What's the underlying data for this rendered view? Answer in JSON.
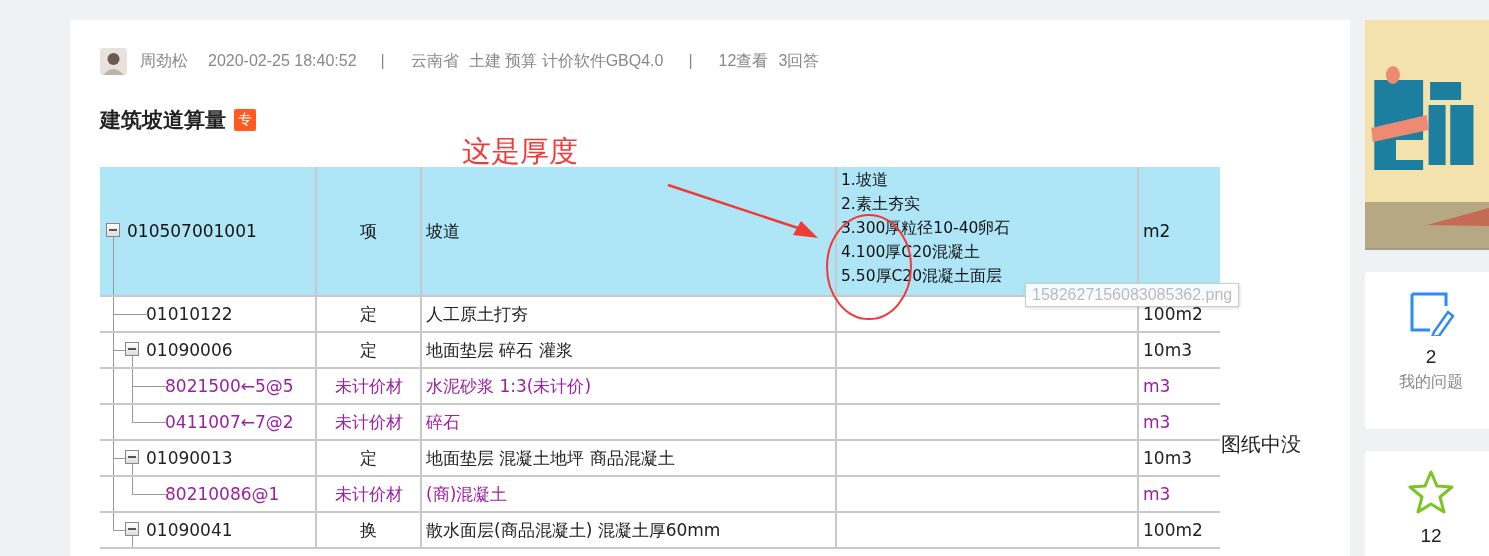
{
  "question": {
    "author": "周劲松",
    "time": "2020-02-25 18:40:52",
    "separator": "|",
    "location": "云南省",
    "tags": "土建 预算 计价软件GBQ4.0",
    "views": "12查看",
    "answers": "3回答",
    "title": "建筑坡道算量",
    "badge": "专"
  },
  "annotation": {
    "text": "这是厚度"
  },
  "table": {
    "rows": [
      {
        "code": "010507001001",
        "type": "项",
        "name": "坡道",
        "description": [
          "1.坡道",
          "2.素土夯实",
          "3.300厚粒径10-40卵石",
          "4.100厚C20混凝土",
          "5.50厚C20混凝土面层"
        ],
        "unit": "m2",
        "kind": "bill",
        "expanded": true,
        "children": [
          {
            "code": "01010122",
            "type": "定",
            "name": "人工原土打夯",
            "unit": "100m2",
            "kind": "quota"
          },
          {
            "code": "01090006",
            "type": "定",
            "name": "地面垫层 碎石 灌浆",
            "unit": "10m3",
            "kind": "quota",
            "expanded": true,
            "children": [
              {
                "code": "8021500←5@5",
                "type": "未计价材",
                "name": "水泥砂浆 1:3(未计价)",
                "unit": "m3",
                "kind": "material"
              },
              {
                "code": "0411007←7@2",
                "type": "未计价材",
                "name": "碎石",
                "unit": "m3",
                "kind": "material"
              }
            ]
          },
          {
            "code": "01090013",
            "type": "定",
            "name": "地面垫层 混凝土地坪 商品混凝土",
            "unit": "10m3",
            "kind": "quota",
            "expanded": true,
            "children": [
              {
                "code": "80210086@1",
                "type": "未计价材",
                "name": "(商)混凝土",
                "unit": "m3",
                "kind": "material"
              }
            ]
          },
          {
            "code": "01090041",
            "type": "换",
            "name": "散水面层(商品混凝土) 混凝土厚60mm",
            "unit": "100m2",
            "kind": "quota",
            "expanded": true
          }
        ]
      }
    ]
  },
  "tooltip": "1582627156083085362.png",
  "side_text": "图纸中没",
  "sidebar": {
    "stats": [
      {
        "kind": "note",
        "count": "2",
        "label": "我的问题"
      },
      {
        "kind": "star",
        "count": "12"
      }
    ]
  }
}
